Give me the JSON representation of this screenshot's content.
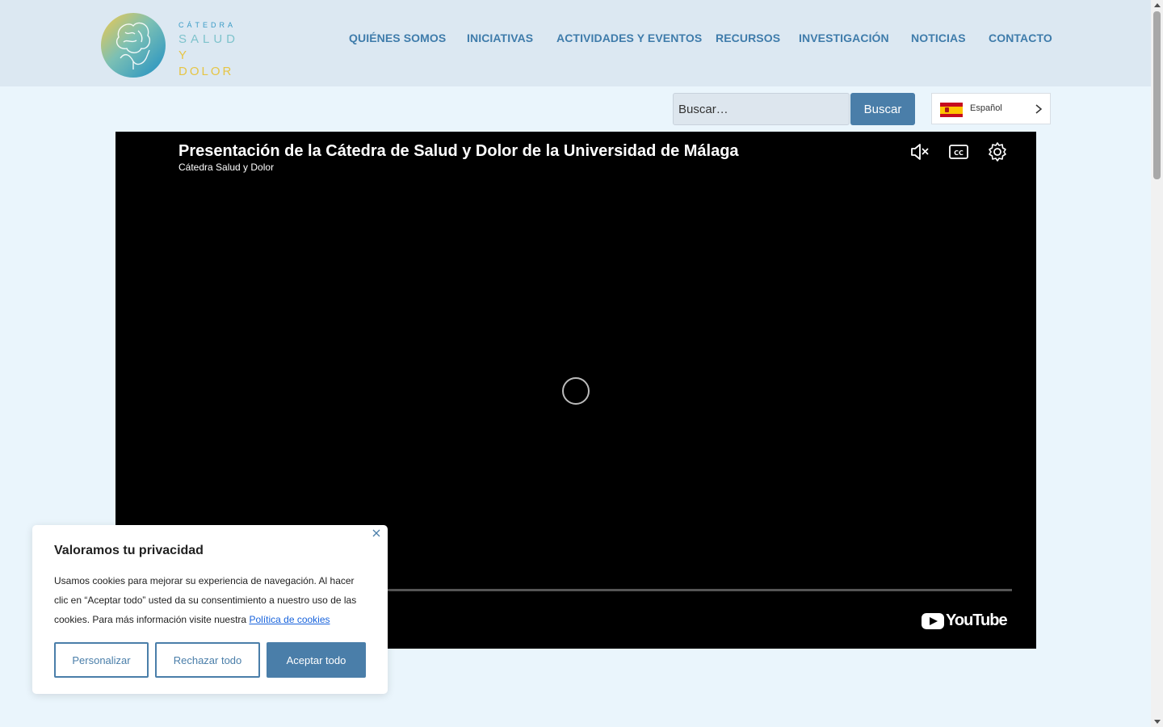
{
  "header": {
    "logo": {
      "line1": "CÁTEDRA",
      "line2": "SALUD",
      "line3": "Y DOLOR"
    },
    "nav": [
      {
        "label": "QUIÉNES SOMOS"
      },
      {
        "label": "INICIATIVAS"
      },
      {
        "label": "ACTIVIDADES Y EVENTOS"
      },
      {
        "label": "RECURSOS"
      },
      {
        "label": "INVESTIGACIÓN"
      },
      {
        "label": "NOTICIAS"
      },
      {
        "label": "CONTACTO"
      }
    ]
  },
  "search": {
    "placeholder": "Buscar…",
    "button_label": "Buscar"
  },
  "language": {
    "label": "Español",
    "flag": "spain-flag-icon"
  },
  "video": {
    "title": "Presentación de la Cátedra de Salud y Dolor de la Universidad de Málaga",
    "channel": "Cátedra Salud y Dolor",
    "controls": [
      "mute-icon",
      "captions-icon",
      "settings-icon"
    ],
    "brand": "YouTube"
  },
  "cookie_banner": {
    "title": "Valoramos tu privacidad",
    "text": "Usamos cookies para mejorar su experiencia de navegación. Al hacer clic en “Aceptar todo” usted da su consentimiento a nuestro uso de las cookies. Para más información visite nuestra",
    "policy_link": "Política de cookies",
    "buttons": {
      "customize": "Personalizar",
      "reject": "Rechazar todo",
      "accept": "Aceptar todo"
    }
  },
  "colors": {
    "accent": "#4a7ea9",
    "nav_text": "#3f7cab",
    "header_bg": "#dce8f2",
    "page_bg": "#eaf5fc"
  }
}
